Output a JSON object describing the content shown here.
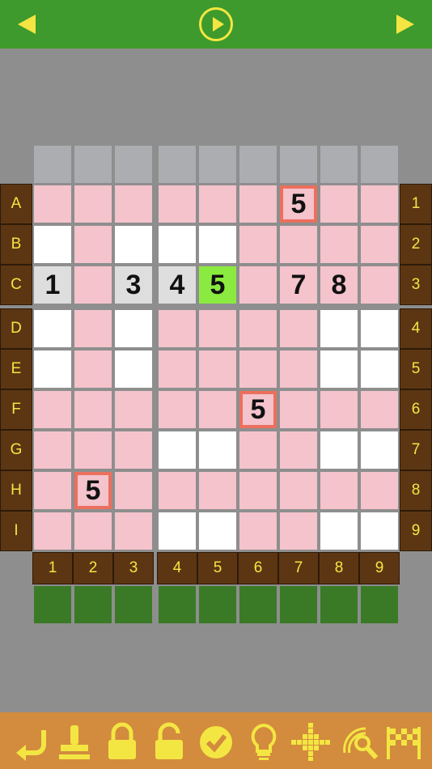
{
  "colors": {
    "topbar": "#3e9a2c",
    "accent_yellow": "#f3e642",
    "cell_pink": "#f4c3cc",
    "cell_white": "#ffffff",
    "cell_given": "#dedede",
    "cell_selected": "#8bea3f",
    "outline": "#ec6f5d",
    "label_brown": "#5c3613",
    "bottombar": "#d38b3d"
  },
  "header": {
    "prev_icon": "triangle-left-icon",
    "play_icon": "play-circle-icon",
    "next_icon": "triangle-right-icon"
  },
  "row_labels_left": [
    "A",
    "B",
    "C",
    "D",
    "E",
    "F",
    "G",
    "H",
    "I"
  ],
  "row_labels_right": [
    "1",
    "2",
    "3",
    "4",
    "5",
    "6",
    "7",
    "8",
    "9"
  ],
  "col_labels": [
    "1",
    "2",
    "3",
    "4",
    "5",
    "6",
    "7",
    "8",
    "9"
  ],
  "grid": [
    [
      {
        "v": "",
        "c": "pink"
      },
      {
        "v": "",
        "c": "pink"
      },
      {
        "v": "",
        "c": "pink"
      },
      {
        "v": "",
        "c": "pink"
      },
      {
        "v": "",
        "c": "pink"
      },
      {
        "v": "",
        "c": "pink"
      },
      {
        "v": "5",
        "c": "pink",
        "o": true
      },
      {
        "v": "",
        "c": "pink"
      },
      {
        "v": "",
        "c": "pink"
      }
    ],
    [
      {
        "v": "",
        "c": "white"
      },
      {
        "v": "",
        "c": "pink"
      },
      {
        "v": "",
        "c": "white"
      },
      {
        "v": "",
        "c": "white"
      },
      {
        "v": "",
        "c": "white"
      },
      {
        "v": "",
        "c": "pink"
      },
      {
        "v": "",
        "c": "pink"
      },
      {
        "v": "",
        "c": "pink"
      },
      {
        "v": "",
        "c": "pink"
      }
    ],
    [
      {
        "v": "1",
        "c": "grey"
      },
      {
        "v": "",
        "c": "pink"
      },
      {
        "v": "3",
        "c": "grey"
      },
      {
        "v": "4",
        "c": "grey"
      },
      {
        "v": "5",
        "c": "green"
      },
      {
        "v": "",
        "c": "pink"
      },
      {
        "v": "7",
        "c": "pink"
      },
      {
        "v": "8",
        "c": "pink"
      },
      {
        "v": "",
        "c": "pink"
      }
    ],
    [
      {
        "v": "",
        "c": "white"
      },
      {
        "v": "",
        "c": "pink"
      },
      {
        "v": "",
        "c": "white"
      },
      {
        "v": "",
        "c": "pink"
      },
      {
        "v": "",
        "c": "pink"
      },
      {
        "v": "",
        "c": "pink"
      },
      {
        "v": "",
        "c": "pink"
      },
      {
        "v": "",
        "c": "white"
      },
      {
        "v": "",
        "c": "white"
      }
    ],
    [
      {
        "v": "",
        "c": "white"
      },
      {
        "v": "",
        "c": "pink"
      },
      {
        "v": "",
        "c": "white"
      },
      {
        "v": "",
        "c": "pink"
      },
      {
        "v": "",
        "c": "pink"
      },
      {
        "v": "",
        "c": "pink"
      },
      {
        "v": "",
        "c": "pink"
      },
      {
        "v": "",
        "c": "white"
      },
      {
        "v": "",
        "c": "white"
      }
    ],
    [
      {
        "v": "",
        "c": "pink"
      },
      {
        "v": "",
        "c": "pink"
      },
      {
        "v": "",
        "c": "pink"
      },
      {
        "v": "",
        "c": "pink"
      },
      {
        "v": "",
        "c": "pink"
      },
      {
        "v": "5",
        "c": "pink",
        "o": true
      },
      {
        "v": "",
        "c": "pink"
      },
      {
        "v": "",
        "c": "pink"
      },
      {
        "v": "",
        "c": "pink"
      }
    ],
    [
      {
        "v": "",
        "c": "pink"
      },
      {
        "v": "",
        "c": "pink"
      },
      {
        "v": "",
        "c": "pink"
      },
      {
        "v": "",
        "c": "white"
      },
      {
        "v": "",
        "c": "white"
      },
      {
        "v": "",
        "c": "pink"
      },
      {
        "v": "",
        "c": "pink"
      },
      {
        "v": "",
        "c": "white"
      },
      {
        "v": "",
        "c": "white"
      }
    ],
    [
      {
        "v": "",
        "c": "pink"
      },
      {
        "v": "5",
        "c": "pink",
        "o": true
      },
      {
        "v": "",
        "c": "pink"
      },
      {
        "v": "",
        "c": "pink"
      },
      {
        "v": "",
        "c": "pink"
      },
      {
        "v": "",
        "c": "pink"
      },
      {
        "v": "",
        "c": "pink"
      },
      {
        "v": "",
        "c": "pink"
      },
      {
        "v": "",
        "c": "pink"
      }
    ],
    [
      {
        "v": "",
        "c": "pink"
      },
      {
        "v": "",
        "c": "pink"
      },
      {
        "v": "",
        "c": "pink"
      },
      {
        "v": "",
        "c": "white"
      },
      {
        "v": "",
        "c": "white"
      },
      {
        "v": "",
        "c": "pink"
      },
      {
        "v": "",
        "c": "pink"
      },
      {
        "v": "",
        "c": "white"
      },
      {
        "v": "",
        "c": "white"
      }
    ]
  ],
  "toolbar": [
    {
      "name": "undo-icon"
    },
    {
      "name": "stamp-icon"
    },
    {
      "name": "lock-icon"
    },
    {
      "name": "unlock-icon"
    },
    {
      "name": "check-icon"
    },
    {
      "name": "lightbulb-icon"
    },
    {
      "name": "cross-dots-icon"
    },
    {
      "name": "magnifier-icon"
    },
    {
      "name": "finish-flag-icon"
    }
  ]
}
